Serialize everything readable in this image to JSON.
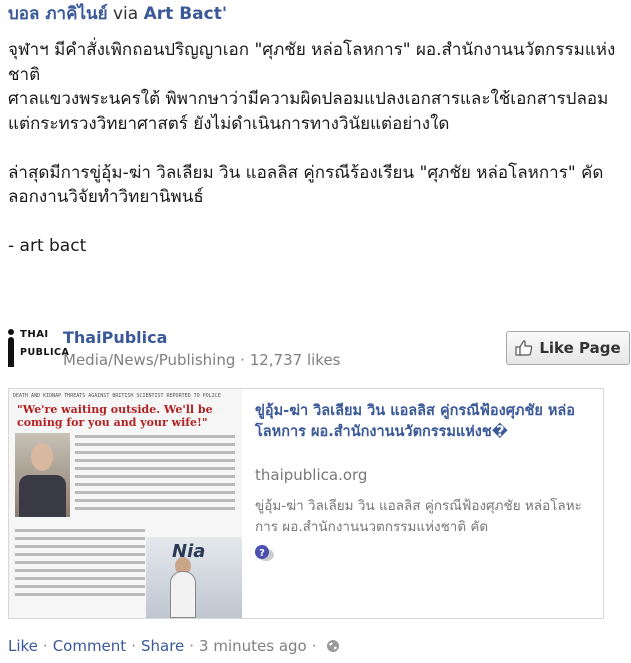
{
  "post": {
    "author": "บอล ภาคิไนย์",
    "via": "via",
    "page": "Art Bact'",
    "body": {
      "line1": "จุฬาฯ มีคำสั่งเพิกถอนปริญญาเอก \"ศุภชัย หล่อโลหการ\" ผอ.สำนักงานนวัตกรรมแห่งชาติ",
      "line2": "ศาลแขวงพระนครใต้ พิพากษาว่ามีความผิดปลอมแปลงเอกสารและใช้เอกสารปลอม",
      "line3": "แต่กระทรวงวิทยาศาสตร์ ยังไม่ดำเนินการทางวินัยแต่อย่างใด",
      "line4": "ล่าสุดมีการขู่อุ้ม-ฆ่า วิลเลียม วิน แอลลิส คู่กรณีร้องเรียน \"ศุภชัย หล่อโลหการ\" คัดลอกงานวิจัยทำวิทยานิพนธ์",
      "line5": "- art bact"
    }
  },
  "shared_page": {
    "logo_top": "THAI",
    "logo_bottom": "PUBLICA",
    "name": "ThaiPublica",
    "category": "Media/News/Publishing",
    "likes": "12,737 likes",
    "like_button": "Like Page"
  },
  "link_card": {
    "thumb_headline": "DEATH AND KIDNAP THREATS AGAINST BRITISH SCIENTIST REPORTED TO POLICE",
    "thumb_quote": "\"We're waiting outside. We'll be coming for you and your wife!\"",
    "thumb_sign": "Nia",
    "title": "ขู่อุ้ม-ฆ่า วิลเลียม วิน แอลลิส คู่กรณีฟ้องศุภชัย หล่อโลหการ ผอ.สำนักงานนวัตกรรมแห่งช�",
    "domain": "thaipublica.org",
    "description": "ขู่อุ้ม-ฆ่า วิลเลียม วิน แอลลิส คู่กรณีฟ้องศุภชัย หล่อโลหะการ ผอ.สำนักงานนวตกรรมแห่งชาติ คัด"
  },
  "footer": {
    "like": "Like",
    "comment": "Comment",
    "share": "Share",
    "time": "3 minutes ago",
    "dot": "·"
  },
  "colors": {
    "link": "#3b5998",
    "meta": "#808080"
  },
  "icons": [
    "thumbs-up-icon",
    "question-icon",
    "globe-icon"
  ]
}
